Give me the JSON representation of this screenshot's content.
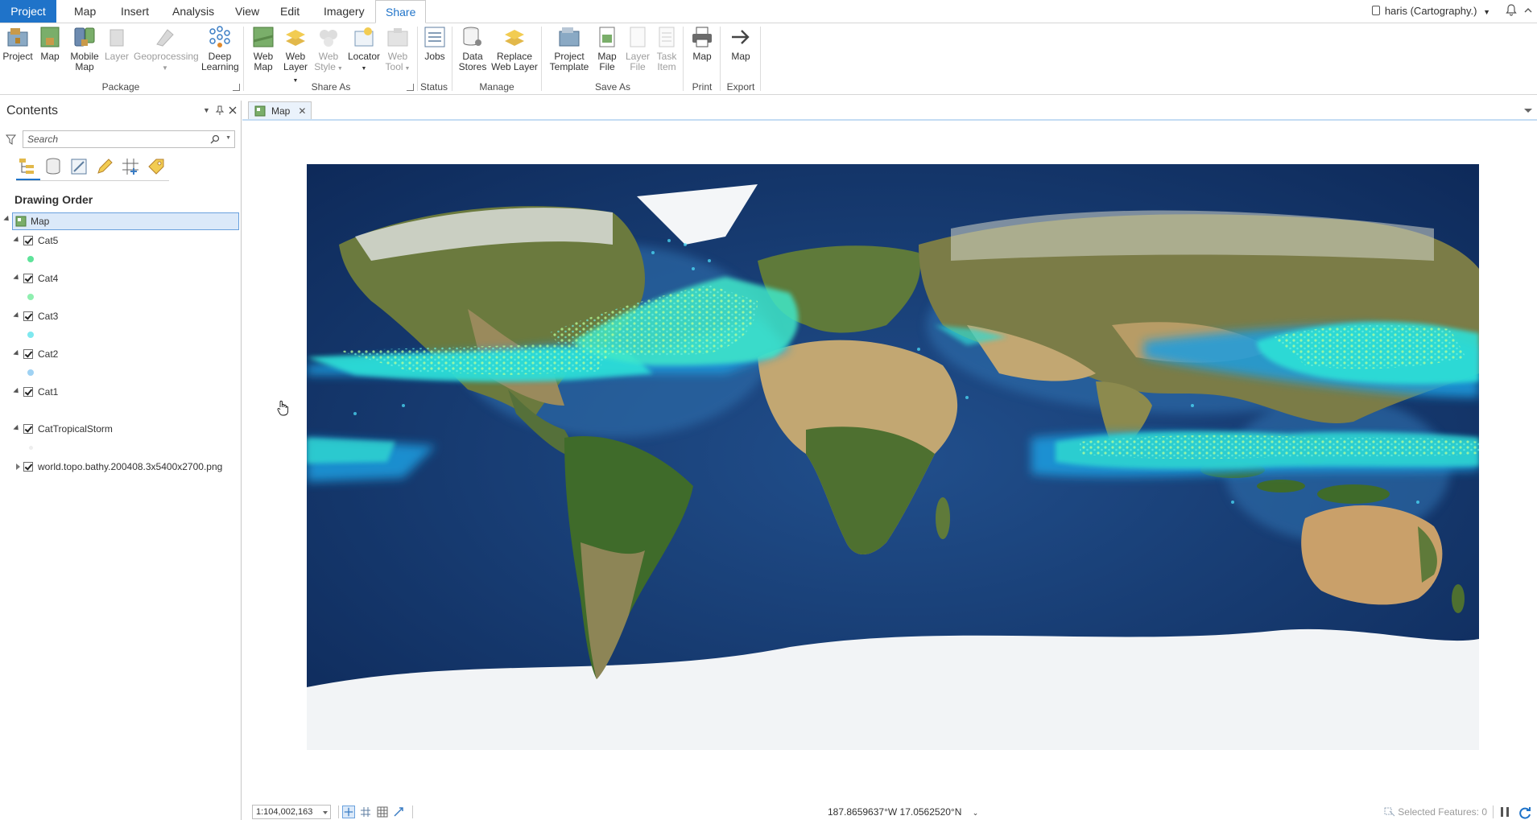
{
  "tabs": [
    "Project",
    "Map",
    "Insert",
    "Analysis",
    "View",
    "Edit",
    "Imagery",
    "Share"
  ],
  "active_tab": "Share",
  "user": "haris (Cartography.)",
  "ribbon": {
    "package": {
      "label": "Package",
      "buttons": [
        {
          "l1": "Project",
          "l2": ""
        },
        {
          "l1": "Map",
          "l2": ""
        },
        {
          "l1": "Mobile",
          "l2": "Map"
        },
        {
          "l1": "Layer",
          "l2": ""
        },
        {
          "l1": "Geoprocessing",
          "l2": ""
        },
        {
          "l1": "Deep",
          "l2": "Learning"
        }
      ]
    },
    "share_as": {
      "label": "Share As",
      "buttons": [
        {
          "l1": "Web",
          "l2": "Map"
        },
        {
          "l1": "Web",
          "l2": "Layer"
        },
        {
          "l1": "Web",
          "l2": "Style"
        },
        {
          "l1": "Locator",
          "l2": ""
        },
        {
          "l1": "Web",
          "l2": "Tool"
        }
      ]
    },
    "status": {
      "label": "Status",
      "buttons": [
        {
          "l1": "Jobs",
          "l2": ""
        }
      ]
    },
    "manage": {
      "label": "Manage",
      "buttons": [
        {
          "l1": "Data",
          "l2": "Stores"
        },
        {
          "l1": "Replace",
          "l2": "Web Layer"
        }
      ]
    },
    "save_as": {
      "label": "Save As",
      "buttons": [
        {
          "l1": "Project",
          "l2": "Template"
        },
        {
          "l1": "Map",
          "l2": "File"
        },
        {
          "l1": "Layer",
          "l2": "File"
        },
        {
          "l1": "Task",
          "l2": "Item"
        }
      ]
    },
    "print": {
      "label": "Print",
      "buttons": [
        {
          "l1": "Map",
          "l2": ""
        }
      ]
    },
    "export": {
      "label": "Export",
      "buttons": [
        {
          "l1": "Map",
          "l2": ""
        }
      ]
    }
  },
  "contents": {
    "title": "Contents",
    "search_placeholder": "Search",
    "section": "Drawing Order",
    "map_name": "Map",
    "layers": [
      {
        "name": "Cat5",
        "color": "#5fe39a"
      },
      {
        "name": "Cat4",
        "color": "#8fefb0"
      },
      {
        "name": "Cat3",
        "color": "#7fe8ef"
      },
      {
        "name": "Cat2",
        "color": "#9fd2f3"
      },
      {
        "name": "Cat1",
        "color": ""
      },
      {
        "name": "CatTropicalStorm",
        "color": "#eeeeee"
      },
      {
        "name": "world.topo.bathy.200408.3x5400x2700.png",
        "color": ""
      }
    ]
  },
  "map_tab": "Map",
  "statusbar": {
    "scale": "1:104,002,163",
    "coordinates": "187.8659637°W 17.0562520°N",
    "selected_features": "Selected Features: 0"
  }
}
